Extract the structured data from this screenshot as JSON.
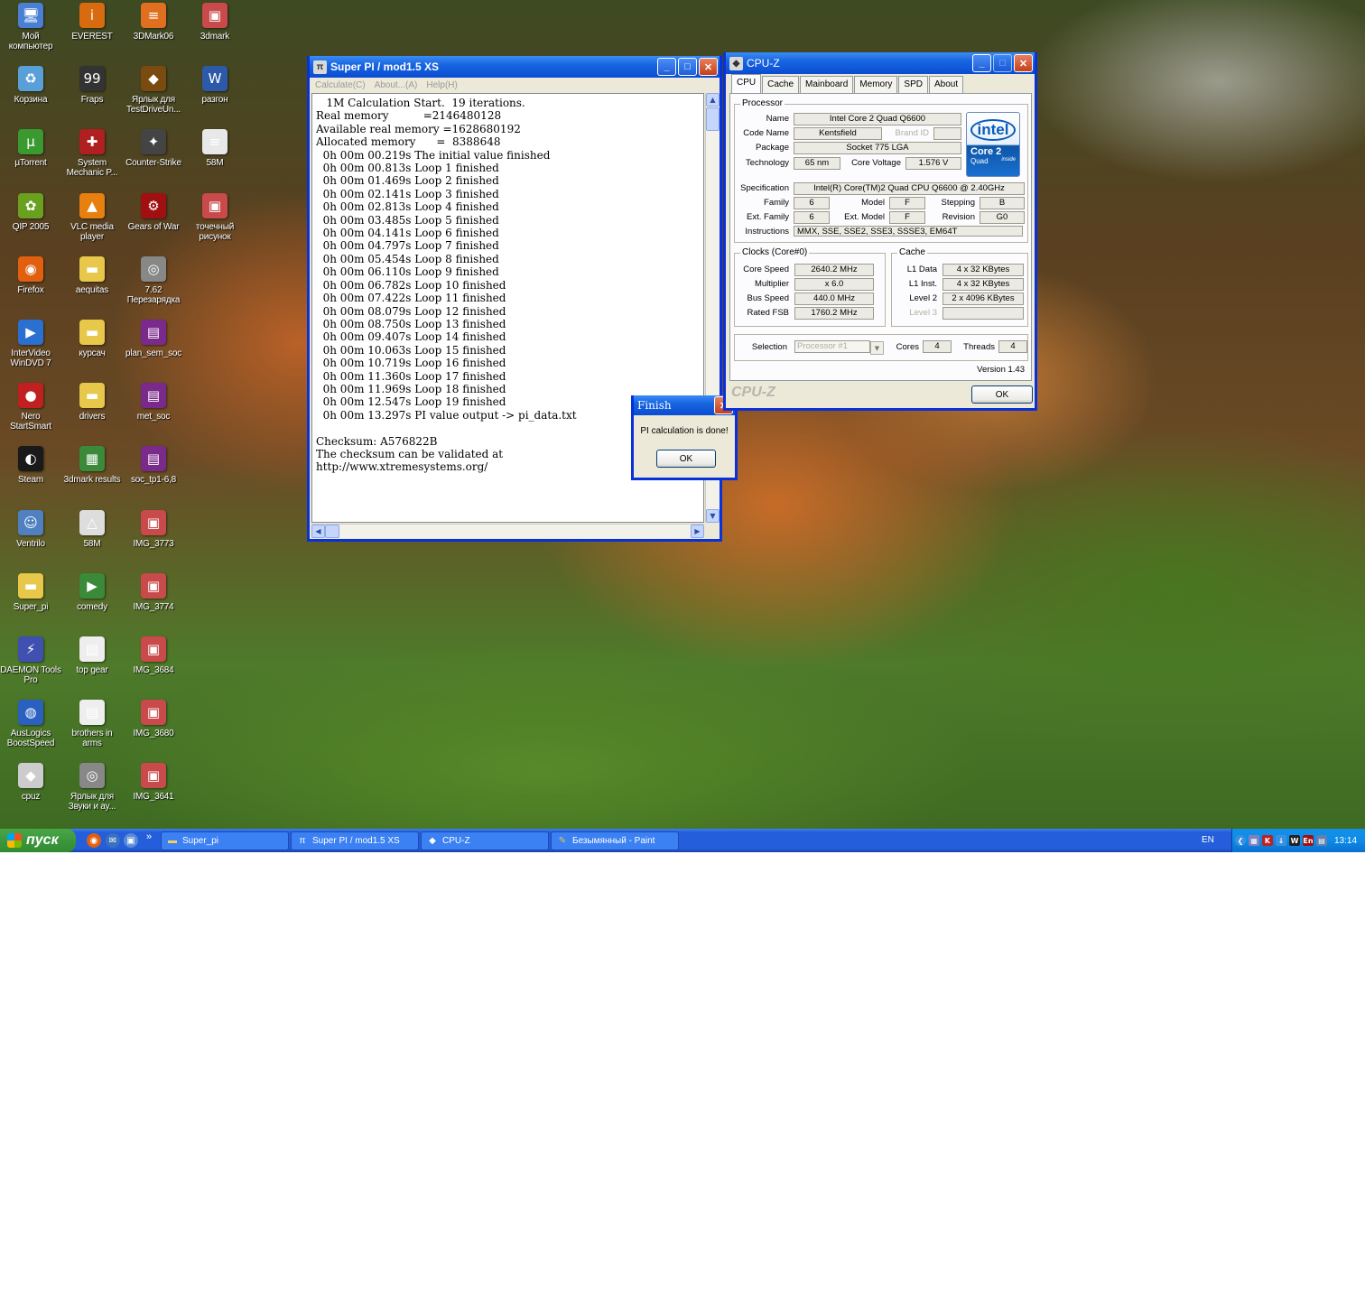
{
  "desktop": {
    "icons": [
      {
        "label": "Мой компьютер",
        "glyph": "🖥",
        "color": "#4a7fd4"
      },
      {
        "label": "EVEREST",
        "glyph": "i",
        "color": "#d86a10"
      },
      {
        "label": "3DMark06",
        "glyph": "≡",
        "color": "#e07020"
      },
      {
        "label": "3dmark",
        "glyph": "▣",
        "color": "#c94a4a"
      },
      {
        "label": "Корзина",
        "glyph": "♻",
        "color": "#5aa0d8"
      },
      {
        "label": "Fraps",
        "glyph": "99",
        "color": "#333333"
      },
      {
        "label": "Ярлык для TestDriveUn...",
        "glyph": "◆",
        "color": "#7a4a10"
      },
      {
        "label": "разгон",
        "glyph": "W",
        "color": "#2c5aa8"
      },
      {
        "label": "µTorrent",
        "glyph": "µ",
        "color": "#3a9a30"
      },
      {
        "label": "System Mechanic P...",
        "glyph": "✚",
        "color": "#b02020"
      },
      {
        "label": "Counter-Strike",
        "glyph": "✦",
        "color": "#444444"
      },
      {
        "label": "58M",
        "glyph": "≡",
        "color": "#e8e8e8"
      },
      {
        "label": "QIP 2005",
        "glyph": "✿",
        "color": "#6aa020"
      },
      {
        "label": "VLC media player",
        "glyph": "▲",
        "color": "#e88010"
      },
      {
        "label": "Gears of War",
        "glyph": "⚙",
        "color": "#a01010"
      },
      {
        "label": "точечный рисунок",
        "glyph": "▣",
        "color": "#c94a4a"
      },
      {
        "label": "Firefox",
        "glyph": "◉",
        "color": "#e06010"
      },
      {
        "label": "aequitas",
        "glyph": "▬",
        "color": "#e8c84a"
      },
      {
        "label": "7.62 Перезарядка",
        "glyph": "◎",
        "color": "#888888"
      },
      {
        "label": "",
        "glyph": "",
        "color": ""
      },
      {
        "label": "InterVideo WinDVD 7",
        "glyph": "▶",
        "color": "#2a70d0"
      },
      {
        "label": "курсач",
        "glyph": "▬",
        "color": "#e8c84a"
      },
      {
        "label": "plan_sem_soc",
        "glyph": "▤",
        "color": "#7a2a8a"
      },
      {
        "label": "",
        "glyph": "",
        "color": ""
      },
      {
        "label": "Nero StartSmart",
        "glyph": "●",
        "color": "#c02020"
      },
      {
        "label": "drivers",
        "glyph": "▬",
        "color": "#e8c84a"
      },
      {
        "label": "met_soc",
        "glyph": "▤",
        "color": "#7a2a8a"
      },
      {
        "label": "",
        "glyph": "",
        "color": ""
      },
      {
        "label": "Steam",
        "glyph": "◐",
        "color": "#1a1a1a"
      },
      {
        "label": "3dmark results",
        "glyph": "▦",
        "color": "#3a8a3a"
      },
      {
        "label": "soc_tp1-6,8",
        "glyph": "▤",
        "color": "#7a2a8a"
      },
      {
        "label": "",
        "glyph": "",
        "color": ""
      },
      {
        "label": "Ventrilo",
        "glyph": "☺",
        "color": "#5080c0"
      },
      {
        "label": "58M",
        "glyph": "△",
        "color": "#dddddd"
      },
      {
        "label": "IMG_3773",
        "glyph": "▣",
        "color": "#c94a4a"
      },
      {
        "label": "",
        "glyph": "",
        "color": ""
      },
      {
        "label": "Super_pi",
        "glyph": "▬",
        "color": "#e8c84a"
      },
      {
        "label": "comedy",
        "glyph": "▶",
        "color": "#3a8a3a"
      },
      {
        "label": "IMG_3774",
        "glyph": "▣",
        "color": "#c94a4a"
      },
      {
        "label": "",
        "glyph": "",
        "color": ""
      },
      {
        "label": "DAEMON Tools Pro",
        "glyph": "⚡",
        "color": "#4050b0"
      },
      {
        "label": "top gear",
        "glyph": "▤",
        "color": "#eeeeee"
      },
      {
        "label": "IMG_3684",
        "glyph": "▣",
        "color": "#c94a4a"
      },
      {
        "label": "",
        "glyph": "",
        "color": ""
      },
      {
        "label": "AusLogics BoostSpeed",
        "glyph": "◍",
        "color": "#2a60c0"
      },
      {
        "label": "brothers in arms",
        "glyph": "▤",
        "color": "#eeeeee"
      },
      {
        "label": "IMG_3680",
        "glyph": "▣",
        "color": "#c94a4a"
      },
      {
        "label": "",
        "glyph": "",
        "color": ""
      },
      {
        "label": "cpuz",
        "glyph": "◆",
        "color": "#cccccc"
      },
      {
        "label": "Ярлык для Звуки и ау...",
        "glyph": "◎",
        "color": "#888888"
      },
      {
        "label": "IMG_3641",
        "glyph": "▣",
        "color": "#c94a4a"
      }
    ]
  },
  "superpi": {
    "title": "Super PI / mod1.5 XS",
    "menu": [
      "Calculate(C)",
      "About...(A)",
      "Help(H)"
    ],
    "output": "   1M Calculation Start.  19 iterations.\nReal memory          =2146480128\nAvailable real memory =1628680192\nAllocated memory      =  8388648\n  0h 00m 00.219s The initial value finished\n  0h 00m 00.813s Loop 1 finished\n  0h 00m 01.469s Loop 2 finished\n  0h 00m 02.141s Loop 3 finished\n  0h 00m 02.813s Loop 4 finished\n  0h 00m 03.485s Loop 5 finished\n  0h 00m 04.141s Loop 6 finished\n  0h 00m 04.797s Loop 7 finished\n  0h 00m 05.454s Loop 8 finished\n  0h 00m 06.110s Loop 9 finished\n  0h 00m 06.782s Loop 10 finished\n  0h 00m 07.422s Loop 11 finished\n  0h 00m 08.079s Loop 12 finished\n  0h 00m 08.750s Loop 13 finished\n  0h 00m 09.407s Loop 14 finished\n  0h 00m 10.063s Loop 15 finished\n  0h 00m 10.719s Loop 16 finished\n  0h 00m 11.360s Loop 17 finished\n  0h 00m 11.969s Loop 18 finished\n  0h 00m 12.547s Loop 19 finished\n  0h 00m 13.297s PI value output -> pi_data.txt\n\nChecksum: A576822B\nThe checksum can be validated at\nhttp://www.xtremesystems.org/"
  },
  "finish": {
    "title": "Finish",
    "message": "PI calculation is done!",
    "ok": "OK"
  },
  "cpuz": {
    "title": "CPU-Z",
    "tabs": [
      "CPU",
      "Cache",
      "Mainboard",
      "Memory",
      "SPD",
      "About"
    ],
    "processor": {
      "group": "Processor",
      "name_label": "Name",
      "name": "Intel Core 2 Quad Q6600",
      "codename_label": "Code Name",
      "codename": "Kentsfield",
      "brandid_label": "Brand ID",
      "brandid": "",
      "package_label": "Package",
      "package": "Socket 775 LGA",
      "technology_label": "Technology",
      "technology": "65 nm",
      "voltage_label": "Core Voltage",
      "voltage": "1.576 V",
      "spec_label": "Specification",
      "spec": "Intel(R) Core(TM)2 Quad CPU    Q6600  @ 2.40GHz",
      "family_label": "Family",
      "family": "6",
      "model_label": "Model",
      "model": "F",
      "stepping_label": "Stepping",
      "stepping": "B",
      "extfamily_label": "Ext. Family",
      "extfamily": "6",
      "extmodel_label": "Ext. Model",
      "extmodel": "F",
      "revision_label": "Revision",
      "revision": "G0",
      "instructions_label": "Instructions",
      "instructions": "MMX, SSE, SSE2, SSE3, SSSE3, EM64T"
    },
    "logo": {
      "brand": "intel",
      "line1": "Core 2",
      "line2": "Quad",
      "line3": "inside"
    },
    "clocks": {
      "group": "Clocks (Core#0)",
      "corespeed_label": "Core Speed",
      "corespeed": "2640.2 MHz",
      "multiplier_label": "Multiplier",
      "multiplier": "x 6.0",
      "busspeed_label": "Bus Speed",
      "busspeed": "440.0 MHz",
      "ratedfsb_label": "Rated FSB",
      "ratedfsb": "1760.2 MHz"
    },
    "cache": {
      "group": "Cache",
      "l1data_label": "L1 Data",
      "l1data": "4 x 32 KBytes",
      "l1inst_label": "L1 Inst.",
      "l1inst": "4 x 32 KBytes",
      "level2_label": "Level 2",
      "level2": "2 x 4096 KBytes",
      "level3_label": "Level 3",
      "level3": ""
    },
    "selection_label": "Selection",
    "selection": "Processor #1",
    "cores_label": "Cores",
    "cores": "4",
    "threads_label": "Threads",
    "threads": "4",
    "version": "Version 1.43",
    "brand_footer": "CPU-Z",
    "ok": "OK"
  },
  "taskbar": {
    "start": "пуск",
    "quicklaunch_more": "»",
    "tasks": [
      "Super_pi",
      "Super PI / mod1.5 XS",
      "CPU-Z",
      "Безымянный - Paint"
    ],
    "lang": "EN",
    "clock": "13:14"
  }
}
